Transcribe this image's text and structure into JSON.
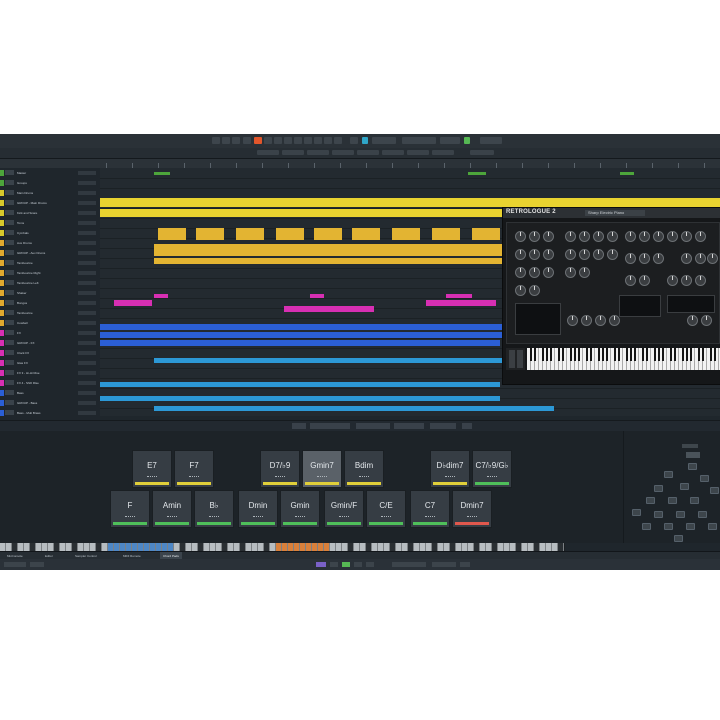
{
  "colors": {
    "background": "#1f262c",
    "accent": "#e2562b",
    "track_yellow": "#e9d330",
    "track_gold": "#e3b432",
    "track_magenta": "#d72fb3",
    "track_blue": "#2b5fd6",
    "track_cyan": "#2c98d6",
    "pad_green": "#4fbf5a",
    "pad_yellow": "#e0cf3a",
    "pad_red": "#e0584d"
  },
  "tracks": [
    {
      "name": "Master",
      "color": "#4da53b"
    },
    {
      "name": "Groups",
      "color": "#4da53b"
    },
    {
      "name": "Main Drums",
      "color": "#d8c92b"
    },
    {
      "name": "GROUP - Main Drums",
      "color": "#d8c92b"
    },
    {
      "name": "Kick and Snare",
      "color": "#d8c92b"
    },
    {
      "name": "Toms",
      "color": "#d8c92b"
    },
    {
      "name": "Cymbals",
      "color": "#d8c92b"
    },
    {
      "name": "Aux Drums",
      "color": "#e1a92e"
    },
    {
      "name": "GROUP - Aux Drums",
      "color": "#e1a92e"
    },
    {
      "name": "Tambourine",
      "color": "#e1a92e"
    },
    {
      "name": "Tambourine Right",
      "color": "#e1a92e"
    },
    {
      "name": "Tambourine Left",
      "color": "#e1a92e"
    },
    {
      "name": "Shaker",
      "color": "#e1a92e"
    },
    {
      "name": "Bongos",
      "color": "#e1a92e"
    },
    {
      "name": "Tambourine",
      "color": "#e1a92e"
    },
    {
      "name": "Cowbell",
      "color": "#e1a92e"
    },
    {
      "name": "FX",
      "color": "#d72fb3"
    },
    {
      "name": "GROUP - FX",
      "color": "#d72fb3"
    },
    {
      "name": "Clock FX",
      "color": "#d72fb3"
    },
    {
      "name": "Glas FX",
      "color": "#d72fb3"
    },
    {
      "name": "FX 3 - Hi-Hi Rise",
      "color": "#d72fb3"
    },
    {
      "name": "FX 4 - Shift Rise",
      "color": "#d72fb3"
    },
    {
      "name": "Bass",
      "color": "#2b5fd6"
    },
    {
      "name": "GROUP - Bass",
      "color": "#2b5fd6"
    },
    {
      "name": "Bass - Mult Brass",
      "color": "#2b5fd6"
    },
    {
      "name": "Bass - Mult Brass",
      "color": "#2b5fd6"
    },
    {
      "name": "Synth - Mult",
      "color": "#2b5fd6"
    },
    {
      "name": "Synths",
      "color": "#2c98d6"
    },
    {
      "name": "GROUP - Synths and Keys",
      "color": "#2c98d6"
    },
    {
      "name": "Pad - Threshold",
      "color": "#2c98d6"
    },
    {
      "name": "Pad - Synth Chords",
      "color": "#2c98d6"
    },
    {
      "name": "INST - Retro Plucks",
      "color": "#2c98d6"
    },
    {
      "name": "Pad - Threshold",
      "color": "#2c98d6"
    },
    {
      "name": "Synth Lead - Retro",
      "color": "#2c98d6"
    },
    {
      "name": "Inst - Various Brass",
      "color": "#2c98d6"
    },
    {
      "name": "Inner Sharp",
      "color": "#2c98d6"
    },
    {
      "name": "Synth Brass - Inst",
      "color": "#2c98d6"
    }
  ],
  "plugin": {
    "name": "RETROLOGUE 2",
    "preset": "Sharp Electric Piano"
  },
  "chord_pads": {
    "top_row": [
      {
        "label": "E7",
        "bar": "#e0cf3a"
      },
      {
        "label": "F7",
        "bar": "#e0cf3a"
      },
      {
        "label": "D7/♭9",
        "bar": "#e0cf3a"
      },
      {
        "label": "Gmin7",
        "bar": "#e0cf3a"
      },
      {
        "label": "Bdim",
        "bar": "#e0cf3a"
      },
      {
        "label": "D♭dim7",
        "bar": "#e0cf3a"
      },
      {
        "label": "C7/♭9/G♭",
        "bar": "#4fbf5a"
      }
    ],
    "bottom_row": [
      {
        "label": "F",
        "bar": "#4fbf5a"
      },
      {
        "label": "Amin",
        "bar": "#4fbf5a"
      },
      {
        "label": "B♭",
        "bar": "#4fbf5a"
      },
      {
        "label": "Dmin",
        "bar": "#4fbf5a"
      },
      {
        "label": "Gmin",
        "bar": "#4fbf5a"
      },
      {
        "label": "Gmin/F",
        "bar": "#4fbf5a"
      },
      {
        "label": "C/E",
        "bar": "#4fbf5a"
      },
      {
        "label": "C7",
        "bar": "#4fbf5a"
      },
      {
        "label": "Dmin7",
        "bar": "#e0584d"
      }
    ]
  },
  "lower_tabs": [
    "MixConsole",
    "Editor",
    "Sampler Control",
    "MIDI Remote",
    "Chord Pads"
  ],
  "active_lower_tab": "Chord Pads"
}
